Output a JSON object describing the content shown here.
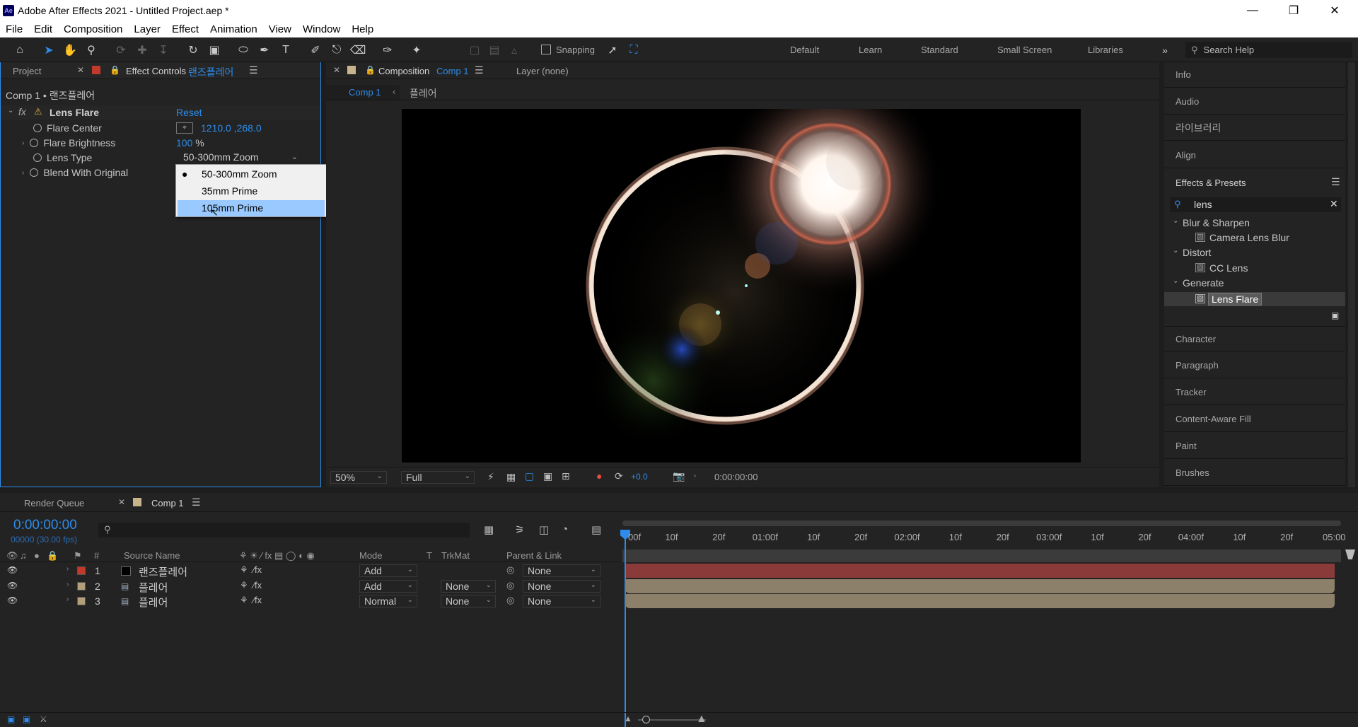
{
  "window": {
    "title": "Adobe After Effects 2021 - Untitled Project.aep *",
    "app_icon": "Ae"
  },
  "menu": [
    "File",
    "Edit",
    "Composition",
    "Layer",
    "Effect",
    "Animation",
    "View",
    "Window",
    "Help"
  ],
  "toolbar": {
    "snapping": "Snapping",
    "workspaces": [
      "Default",
      "Learn",
      "Standard",
      "Small Screen",
      "Libraries"
    ],
    "search_placeholder": "Search Help"
  },
  "left_panel": {
    "tab_project": "Project",
    "tab_effect_controls": "Effect Controls",
    "effect_layer": "랜즈플레어",
    "breadcrumb": "Comp 1 • 랜즈플레어",
    "effect_name": "Lens Flare",
    "reset": "Reset",
    "props": [
      {
        "label": "Flare Center",
        "value": "1210.0 ,268.0"
      },
      {
        "label": "Flare Brightness",
        "value": "100",
        "unit": "%"
      },
      {
        "label": "Lens Type",
        "value": "50-300mm Zoom"
      },
      {
        "label": "Blend With Original",
        "value": ""
      }
    ],
    "dropdown": [
      "50-300mm Zoom",
      "35mm Prime",
      "105mm Prime"
    ]
  },
  "comp_panel": {
    "tab_label": "Composition",
    "tab_comp": "Comp 1",
    "layer_label": "Layer (none)",
    "flow": [
      "Comp 1",
      "플레어"
    ],
    "zoom": "50%",
    "resolution": "Full",
    "exposure": "+0.0",
    "timecode": "0:00:00:00"
  },
  "right_panel": {
    "tabs_top": [
      "Info",
      "Audio",
      "라이브러리",
      "Align"
    ],
    "effects_presets": "Effects & Presets",
    "search_value": "lens",
    "tree": [
      {
        "cat": "Blur & Sharpen",
        "item": "Camera Lens Blur"
      },
      {
        "cat": "Distort",
        "item": "CC Lens"
      },
      {
        "cat": "Generate",
        "item": "Lens Flare"
      }
    ],
    "tabs_bottom": [
      "Character",
      "Paragraph",
      "Tracker",
      "Content-Aware Fill",
      "Paint",
      "Brushes"
    ]
  },
  "timeline": {
    "tab_render": "Render Queue",
    "tab_comp": "Comp 1",
    "time": "0:00:00:00",
    "fps": "00000 (30.00 fps)",
    "headers": {
      "num": "#",
      "source": "Source Name",
      "mode": "Mode",
      "t": "T",
      "trkmat": "TrkMat",
      "parent": "Parent & Link"
    },
    "layers": [
      {
        "num": "1",
        "name": "랜즈플레어",
        "mode": "Add",
        "trkmat": "",
        "parent": "None",
        "color": "#c0392b",
        "bar": "#8b3a3a"
      },
      {
        "num": "2",
        "name": "플레어",
        "mode": "Add",
        "trkmat": "None",
        "parent": "None",
        "color": "#b3a07a",
        "bar": "#8c806a"
      },
      {
        "num": "3",
        "name": "플레어",
        "mode": "Normal",
        "trkmat": "None",
        "parent": "None",
        "color": "#b3a07a",
        "bar": "#8c806a"
      }
    ],
    "ruler": [
      "00f",
      "10f",
      "20f",
      "01:00f",
      "10f",
      "20f",
      "02:00f",
      "10f",
      "20f",
      "03:00f",
      "10f",
      "20f",
      "04:00f",
      "10f",
      "20f",
      "05:00"
    ]
  }
}
